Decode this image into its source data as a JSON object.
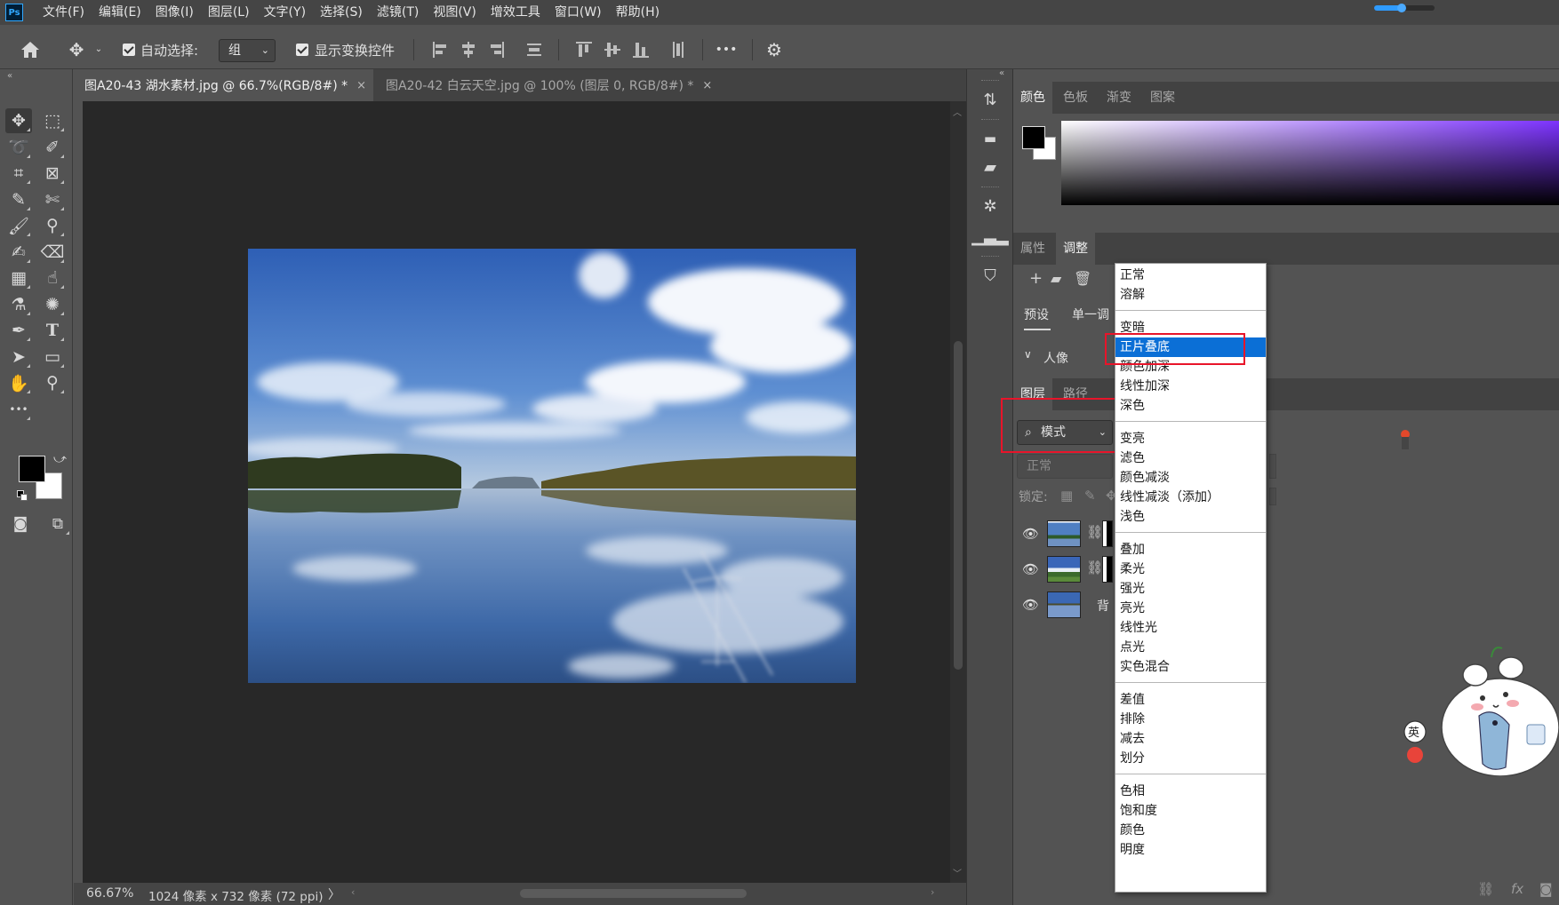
{
  "app": {
    "logo_text": "Ps"
  },
  "menu": [
    "文件(F)",
    "编辑(E)",
    "图像(I)",
    "图层(L)",
    "文字(Y)",
    "选择(S)",
    "滤镜(T)",
    "视图(V)",
    "增效工具",
    "窗口(W)",
    "帮助(H)"
  ],
  "options": {
    "auto_select_label": "自动选择:",
    "auto_select_value": "组",
    "show_transform_label": "显示变换控件",
    "more_label": "•••"
  },
  "tabs": [
    {
      "label": "图A20-43 湖水素材.jpg @ 66.7%(RGB/8#) *",
      "close": "×",
      "active": true
    },
    {
      "label": "图A20-42 白云天空.jpg @ 100% (图层 0, RGB/8#) *",
      "close": "×",
      "active": false
    }
  ],
  "status": {
    "zoom": "66.67%",
    "dimensions": "1024 像素 x 732 像素 (72 ppi)",
    "chevron": "〉"
  },
  "color_panel": {
    "tabs": [
      "颜色",
      "色板",
      "渐变",
      "图案"
    ]
  },
  "adjust_panel": {
    "tabs": [
      "属性",
      "调整"
    ],
    "preset_label": "预设",
    "single_label": "单一调",
    "group_label": "人像"
  },
  "layers_panel": {
    "tabs": [
      "图层",
      "路径"
    ],
    "search_value": "模式",
    "blend_value": "正常",
    "lock_label": "锁定:",
    "background_name": "背"
  },
  "blend_menu": {
    "groups": [
      [
        "正常",
        "溶解"
      ],
      [
        "变暗",
        "正片叠底",
        "颜色加深",
        "线性加深",
        "深色"
      ],
      [
        "变亮",
        "滤色",
        "颜色减淡",
        "线性减淡（添加）",
        "浅色"
      ],
      [
        "叠加",
        "柔光",
        "强光",
        "亮光",
        "线性光",
        "点光",
        "实色混合"
      ],
      [
        "差值",
        "排除",
        "减去",
        "划分"
      ],
      [
        "色相",
        "饱和度",
        "颜色",
        "明度"
      ]
    ],
    "selected": "正片叠底"
  },
  "mascot": {
    "badge_text": "英"
  },
  "zoom_slider": {
    "value": 0.45
  },
  "colors": {
    "accent": "#0b6fd6",
    "highlight_box": "#e8142a",
    "foreground": "#000000",
    "background": "#ffffff"
  },
  "icons": {
    "tools": [
      "move-icon",
      "marquee-icon",
      "lasso-icon",
      "quick-select-icon",
      "crop-icon",
      "frame-icon",
      "eyedropper-icon",
      "healing-icon",
      "brush-icon",
      "stamp-icon",
      "history-brush-icon",
      "eraser-icon",
      "gradient-icon",
      "smudge-icon",
      "dodge-icon",
      "sponge-icon",
      "pen-icon",
      "type-icon",
      "path-select-icon",
      "rectangle-icon",
      "hand-icon",
      "zoom-icon",
      "more-tools-icon"
    ]
  }
}
